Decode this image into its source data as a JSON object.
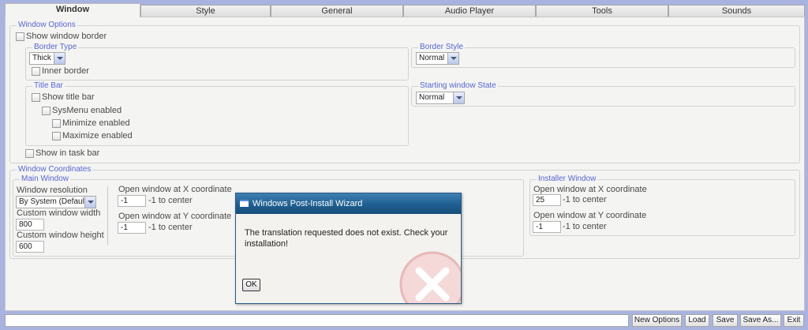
{
  "tabs": [
    {
      "label": "Window",
      "active": true
    },
    {
      "label": "Style",
      "active": false
    },
    {
      "label": "General",
      "active": false
    },
    {
      "label": "Audio Player",
      "active": false
    },
    {
      "label": "Tools",
      "active": false
    },
    {
      "label": "Sounds",
      "active": false
    }
  ],
  "window_options": {
    "legend": "Window Options",
    "show_window_border": {
      "label": "Show window border",
      "checked": false
    },
    "border_type": {
      "legend": "Border Type",
      "value": "Thick",
      "inner_border_label": "Inner border",
      "inner_border_checked": false
    },
    "border_style": {
      "legend": "Border Style",
      "value": "Normal"
    },
    "title_bar": {
      "legend": "Title Bar",
      "show_title_bar": "Show title bar",
      "sysmenu": "SysMenu enabled",
      "minimize": "Minimize enabled",
      "maximize": "Maximize enabled"
    },
    "starting_state": {
      "legend": "Starting window State",
      "value": "Normal"
    },
    "show_in_taskbar": "Show in task bar"
  },
  "window_coordinates": {
    "legend": "Window Coordinates",
    "main_window": {
      "legend": "Main Window",
      "resolution_label": "Window resolution",
      "resolution_value": "By System (Default)",
      "width_label": "Custom window width",
      "width_value": "800",
      "height_label": "Custom window height",
      "height_value": "600",
      "x_label": "Open window at X coordinate",
      "x_value": "-1",
      "x_hint": "-1 to center",
      "y_label": "Open window at Y coordinate",
      "y_value": "-1",
      "y_hint": "-1 to center"
    },
    "installer_window": {
      "legend": "Installer Window",
      "x_label": "Open window at X coordinate",
      "x_value": "25",
      "x_hint": "-1 to center",
      "y_label": "Open window at Y coordinate",
      "y_value": "-1",
      "y_hint": "-1 to center"
    }
  },
  "dialog": {
    "title": "Windows Post-Install Wizard",
    "message": "The translation requested does not exist. Check your installation!",
    "ok_label": "OK",
    "icon": "error-x-icon"
  },
  "footer": {
    "buttons": [
      "New Options",
      "Load",
      "Save",
      "Save As...",
      "Exit"
    ]
  },
  "colors": {
    "background": "#a9b3e0",
    "legend": "#5866d2",
    "dialog_title": "#1f5f91",
    "error_icon": "#d94a4a"
  }
}
